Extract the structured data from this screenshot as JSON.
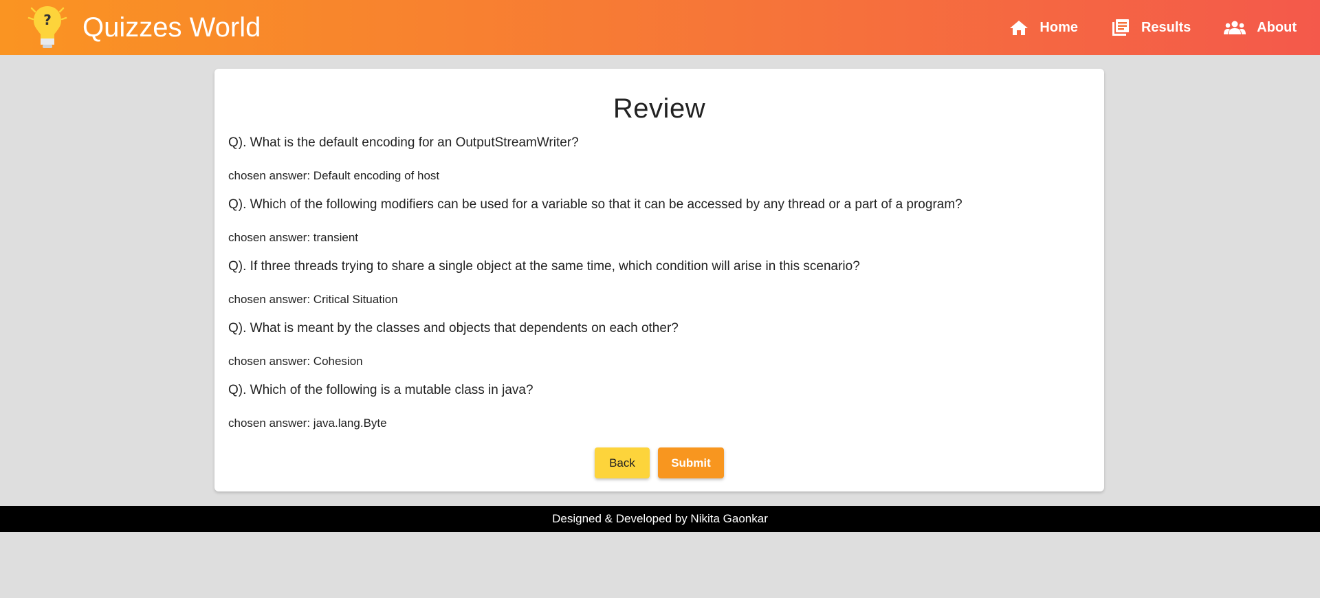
{
  "header": {
    "title": "Quizzes World",
    "nav": [
      {
        "label": "Home",
        "icon": "home-icon"
      },
      {
        "label": "Results",
        "icon": "results-icon"
      },
      {
        "label": "About",
        "icon": "people-icon"
      }
    ]
  },
  "review": {
    "heading": "Review",
    "items": [
      {
        "question": "Q). What is the default encoding for an OutputStreamWriter?",
        "answer": "chosen answer: Default encoding of host"
      },
      {
        "question": "Q). Which of the following modifiers can be used for a variable so that it can be accessed by any thread or a part of a program?",
        "answer": "chosen answer: transient"
      },
      {
        "question": "Q). If three threads trying to share a single object at the same time, which condition will arise in this scenario?",
        "answer": "chosen answer: Critical Situation"
      },
      {
        "question": "Q). What is meant by the classes and objects that dependents on each other?",
        "answer": "chosen answer: Cohesion"
      },
      {
        "question": "Q). Which of the following is a mutable class in java?",
        "answer": "chosen answer: java.lang.Byte"
      }
    ],
    "back_label": "Back",
    "submit_label": "Submit"
  },
  "footer": {
    "text": "Designed & Developed by Nikita Gaonkar"
  },
  "colors": {
    "header_start": "#fa9422",
    "header_end": "#f4594b",
    "back_button": "#fdd43b",
    "submit_button": "#f8961f",
    "background": "#dedede",
    "footer": "#000000"
  }
}
